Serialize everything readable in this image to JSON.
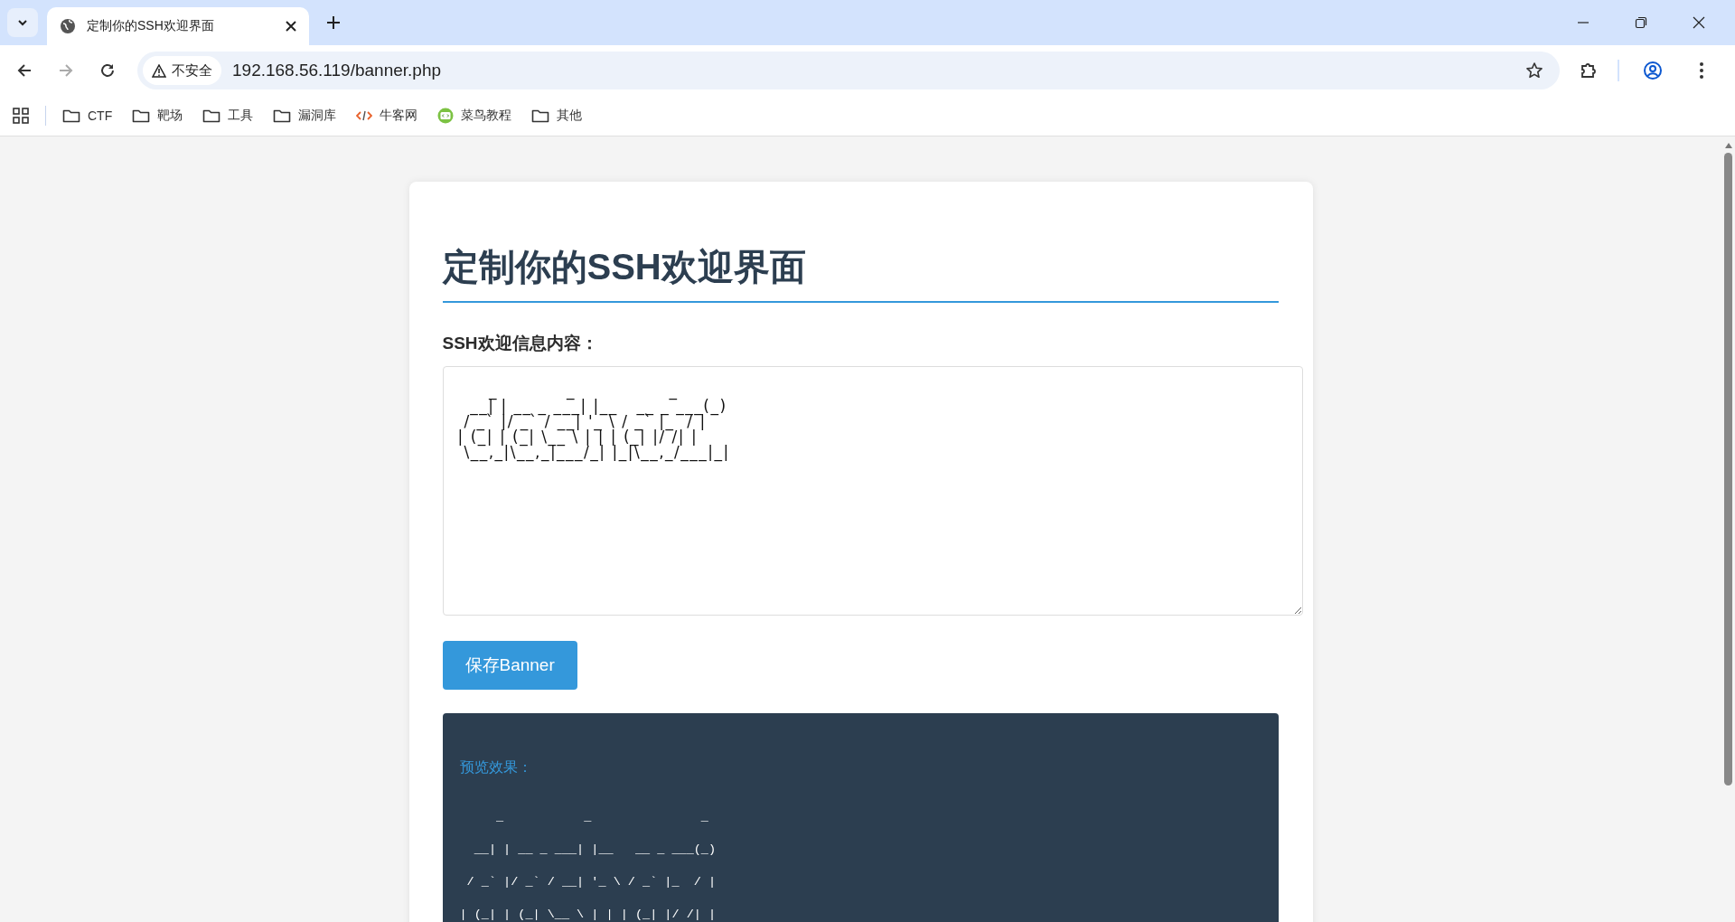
{
  "browser": {
    "tab_title": "定制你的SSH欢迎界面",
    "security_label": "不安全",
    "url": "192.168.56.119/banner.php",
    "bookmarks": [
      {
        "label": "CTF",
        "kind": "folder"
      },
      {
        "label": "靶场",
        "kind": "folder"
      },
      {
        "label": "工具",
        "kind": "folder"
      },
      {
        "label": "漏洞库",
        "kind": "folder"
      },
      {
        "label": "牛客网",
        "kind": "code"
      },
      {
        "label": "菜鸟教程",
        "kind": "badge"
      },
      {
        "label": "其他",
        "kind": "folder"
      }
    ]
  },
  "page": {
    "heading": "定制你的SSH欢迎界面",
    "field_label": "SSH欢迎信息内容：",
    "banner_text": "     _           _               _ \n  __| | __ _ ___| |__   __ _ ___(_)\n / _` |/ _` / __| '_ \\ / _` |_  / |\n| (_| | (_| \\__ \\ | | | (_| |/ /| |\n \\__,_|\\__,_|___/_| |_|\\__,_/___|_|",
    "save_button": "保存Banner",
    "preview_label": "预览效果：",
    "preview_lines": [
      "     _           _               _ ",
      "  __| | __ _ ___| |__   __ _ ___(_)",
      " / _` |/ _` / __| '_ \\ / _` |_  / |",
      "| (_| | (_| \\__ \\ | | | (_| |/ /| |"
    ]
  }
}
